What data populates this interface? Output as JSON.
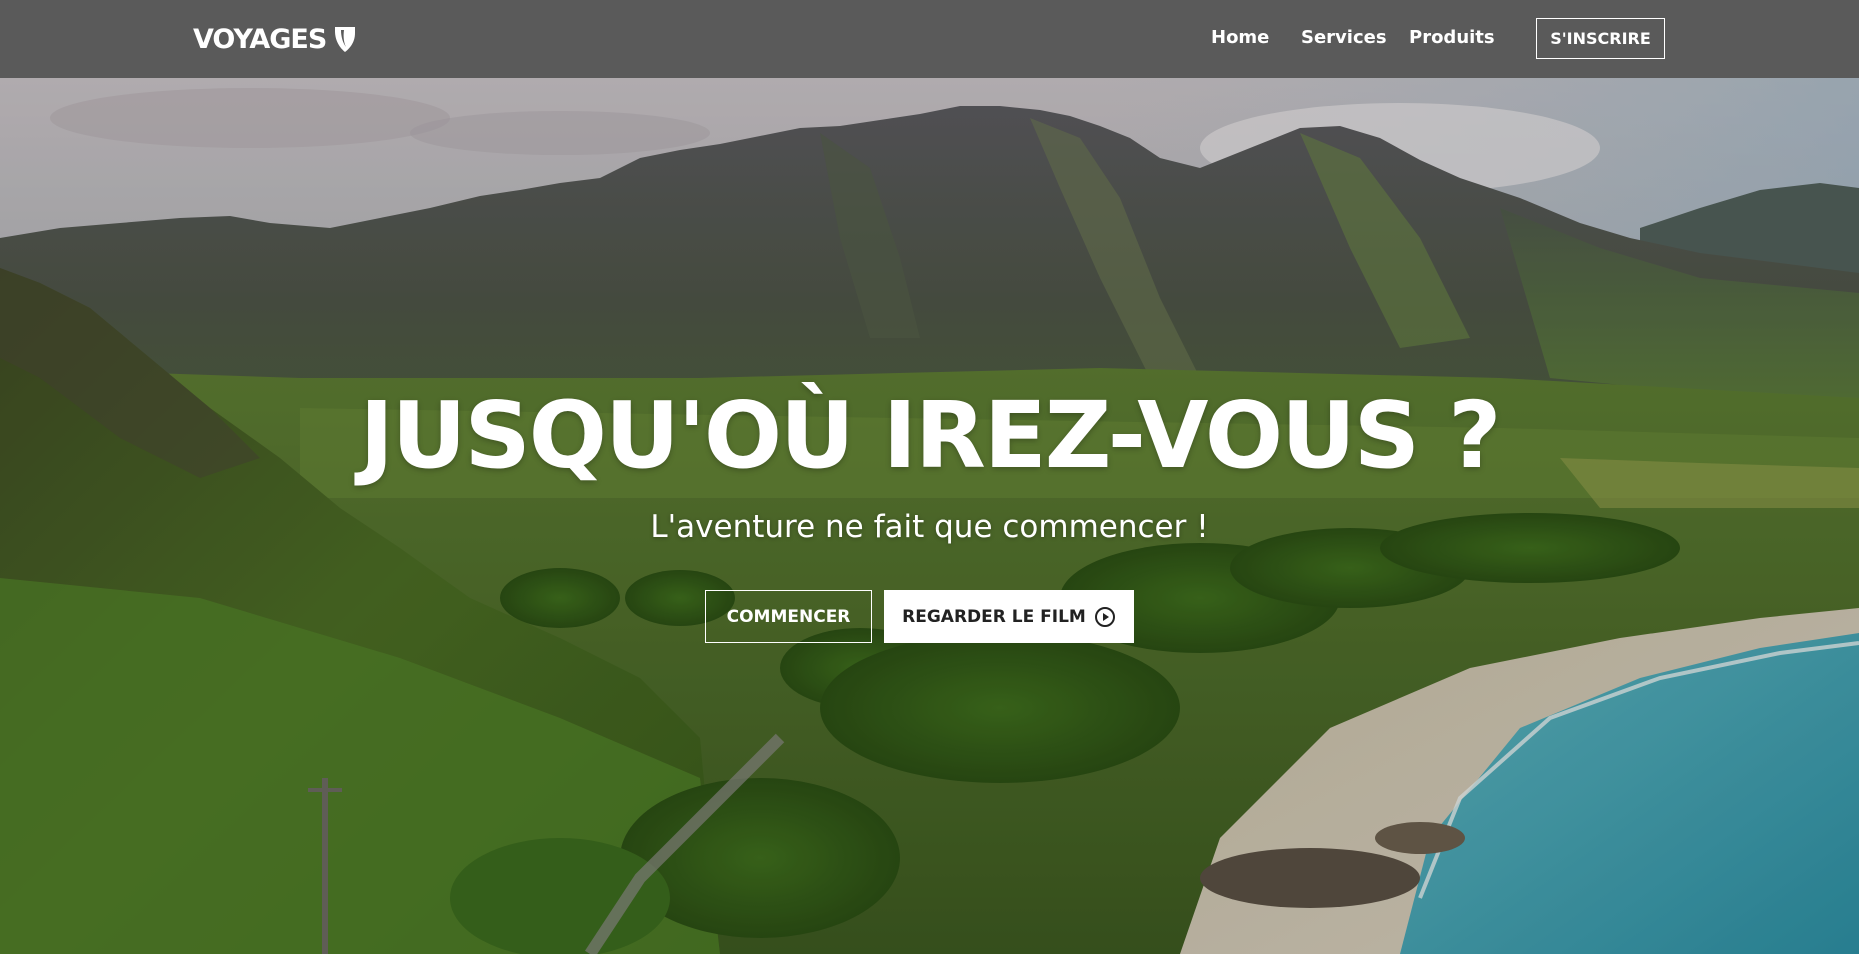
{
  "brand": {
    "name": "VOYAGES",
    "logo_icon": "typo3-shield-icon"
  },
  "nav": {
    "items": [
      {
        "label": "Home"
      },
      {
        "label": "Services"
      },
      {
        "label": "Produits"
      }
    ],
    "signup_label": "S'INSCRIRE"
  },
  "hero": {
    "title": "JUSQU'OÙ IREZ-VOUS ?",
    "subtitle": "L'aventure ne fait que commencer !",
    "primary_button": "COMMENCER",
    "secondary_button": "REGARDER LE FILM",
    "secondary_icon": "play-circle-icon",
    "background": "mountain-coast-landscape-photo"
  },
  "colors": {
    "navbar_bg": "#5a5a5a",
    "text": "#ffffff",
    "button_dark_text": "#222222"
  }
}
